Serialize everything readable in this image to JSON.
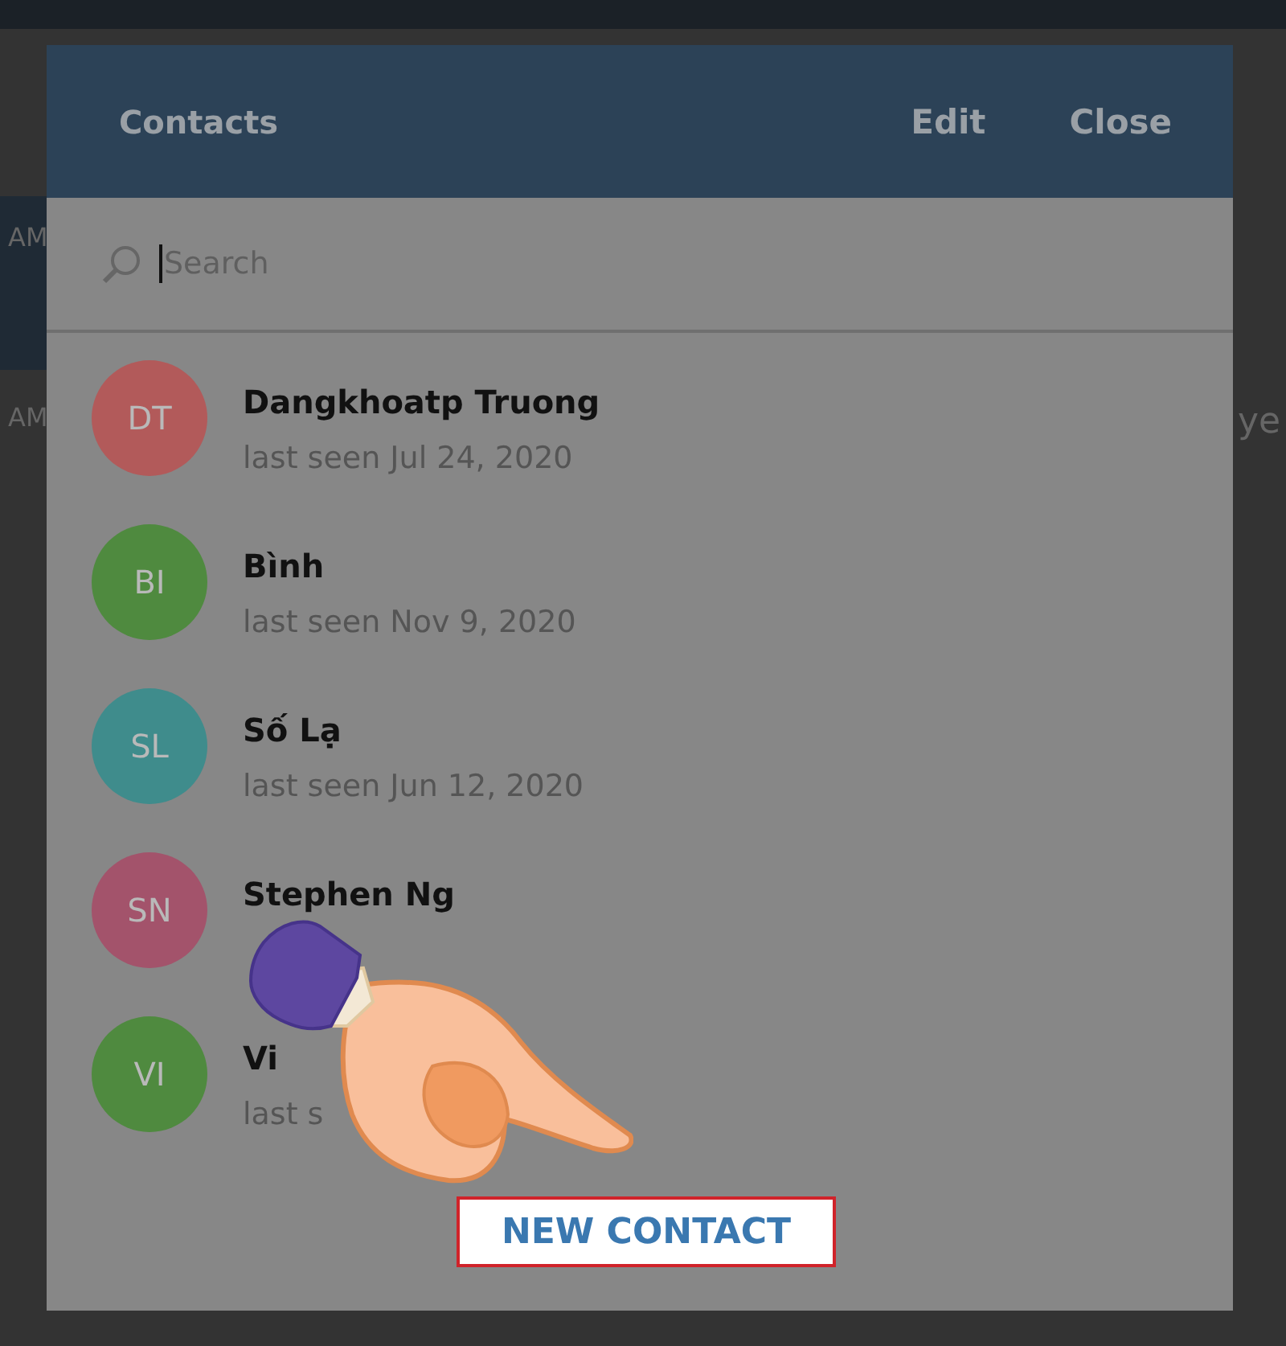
{
  "background": {
    "left_fragments": [
      "AM",
      "AM"
    ],
    "right_fragment": "ye"
  },
  "dialog": {
    "title": "Contacts",
    "actions": [
      "Edit",
      "Close"
    ],
    "search": {
      "placeholder": "Search"
    },
    "contacts": [
      {
        "initials": "DT",
        "color": "#b25a5a",
        "name": "Dangkhoatp Truong",
        "status": "last seen Jul 24, 2020"
      },
      {
        "initials": "BI",
        "color": "#4f8a3f",
        "name": "Bình",
        "status": "last seen Nov 9, 2020"
      },
      {
        "initials": "SL",
        "color": "#3f8c8c",
        "name": "Số Lạ",
        "status": "last seen Jun 12, 2020"
      },
      {
        "initials": "SN",
        "color": "#a3536b",
        "name": "Stephen Ng"
      },
      {
        "initials": "VI",
        "color": "#4f8a3f",
        "name": "Vi",
        "status": "last s"
      }
    ],
    "new_contact": "NEW CONTACT"
  }
}
